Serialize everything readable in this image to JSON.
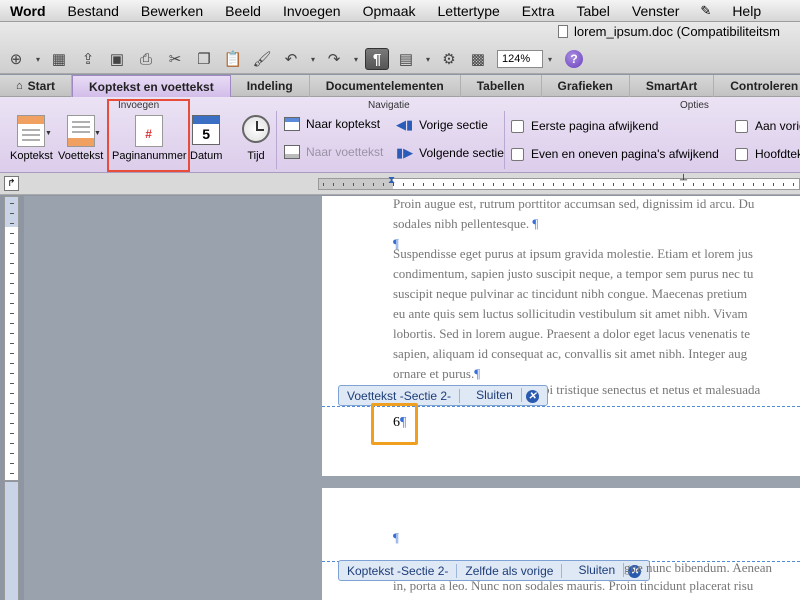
{
  "menubar": {
    "app_name": "Word",
    "items": [
      "Bestand",
      "Bewerken",
      "Beeld",
      "Invoegen",
      "Opmaak",
      "Lettertype",
      "Extra",
      "Tabel",
      "Venster",
      "Help"
    ]
  },
  "toolbar": {
    "doc_title": "lorem_ipsum.doc (Compatibiliteitsm",
    "zoom": "124%"
  },
  "ribbon_tabs": [
    "Start",
    "Koptekst en voettekst",
    "Indeling",
    "Documentelementen",
    "Tabellen",
    "Grafieken",
    "SmartArt",
    "Controleren"
  ],
  "ribbon": {
    "groups": {
      "insert": "Invoegen",
      "navigation": "Navigatie",
      "options": "Opties"
    },
    "buttons": {
      "header": "Koptekst",
      "footer": "Voettekst",
      "page_number": "Paginanummer",
      "date": "Datum",
      "date_icon_number": "5",
      "time": "Tijd"
    },
    "navigation": {
      "go_to_header": "Naar koptekst",
      "go_to_footer": "Naar voettekst",
      "previous_section": "Vorige sectie",
      "next_section": "Volgende sectie"
    },
    "options": {
      "different_first_page": "Eerste pagina afwijkend",
      "different_odd_even": "Even en oneven pagina's afwijkend",
      "show_document_text": "Aan vorig",
      "header_text": "Hoofdtek"
    }
  },
  "document": {
    "page1_lines": [
      "Proin augue est, rutrum porttitor accumsan sed, dignissim id arcu. Du",
      "sodales nibh pellentesque."
    ],
    "paragraph2": [
      "Suspendisse eget purus at ipsum gravida molestie. Etiam et lorem jus",
      "condimentum, sapien justo suscipit neque, a tempor sem purus nec tu",
      "suscipit neque pulvinar ac tincidunt nibh congue. Maecenas pretium",
      "eu ante quis sem luctus sollicitudin vestibulum sit amet nibh. Vivam",
      "lobortis. Sed in lorem augue. Praesent a dolor eget lacus venenatis te",
      "sapien, aliquam id consequat ac, convallis sit amet nibh. Integer aug",
      "ornare et purus."
    ],
    "partial_line": "morbi tristique senectus et netus et malesuada",
    "pilcrow": "¶",
    "footer_tab": {
      "label": "Voettekst -Sectie 2-",
      "close": "Sluiten"
    },
    "footer_page_number": "6",
    "header_tab": {
      "label": "Koptekst -Sectie 2-",
      "same_as_previous": "Zelfde als vorige",
      "close": "Sluiten"
    },
    "page2_lines": [
      "gue nunc bibendum. Aenean",
      "in, porta a leo. Nunc non sodales mauris. Proin tincidunt placerat risu"
    ]
  }
}
